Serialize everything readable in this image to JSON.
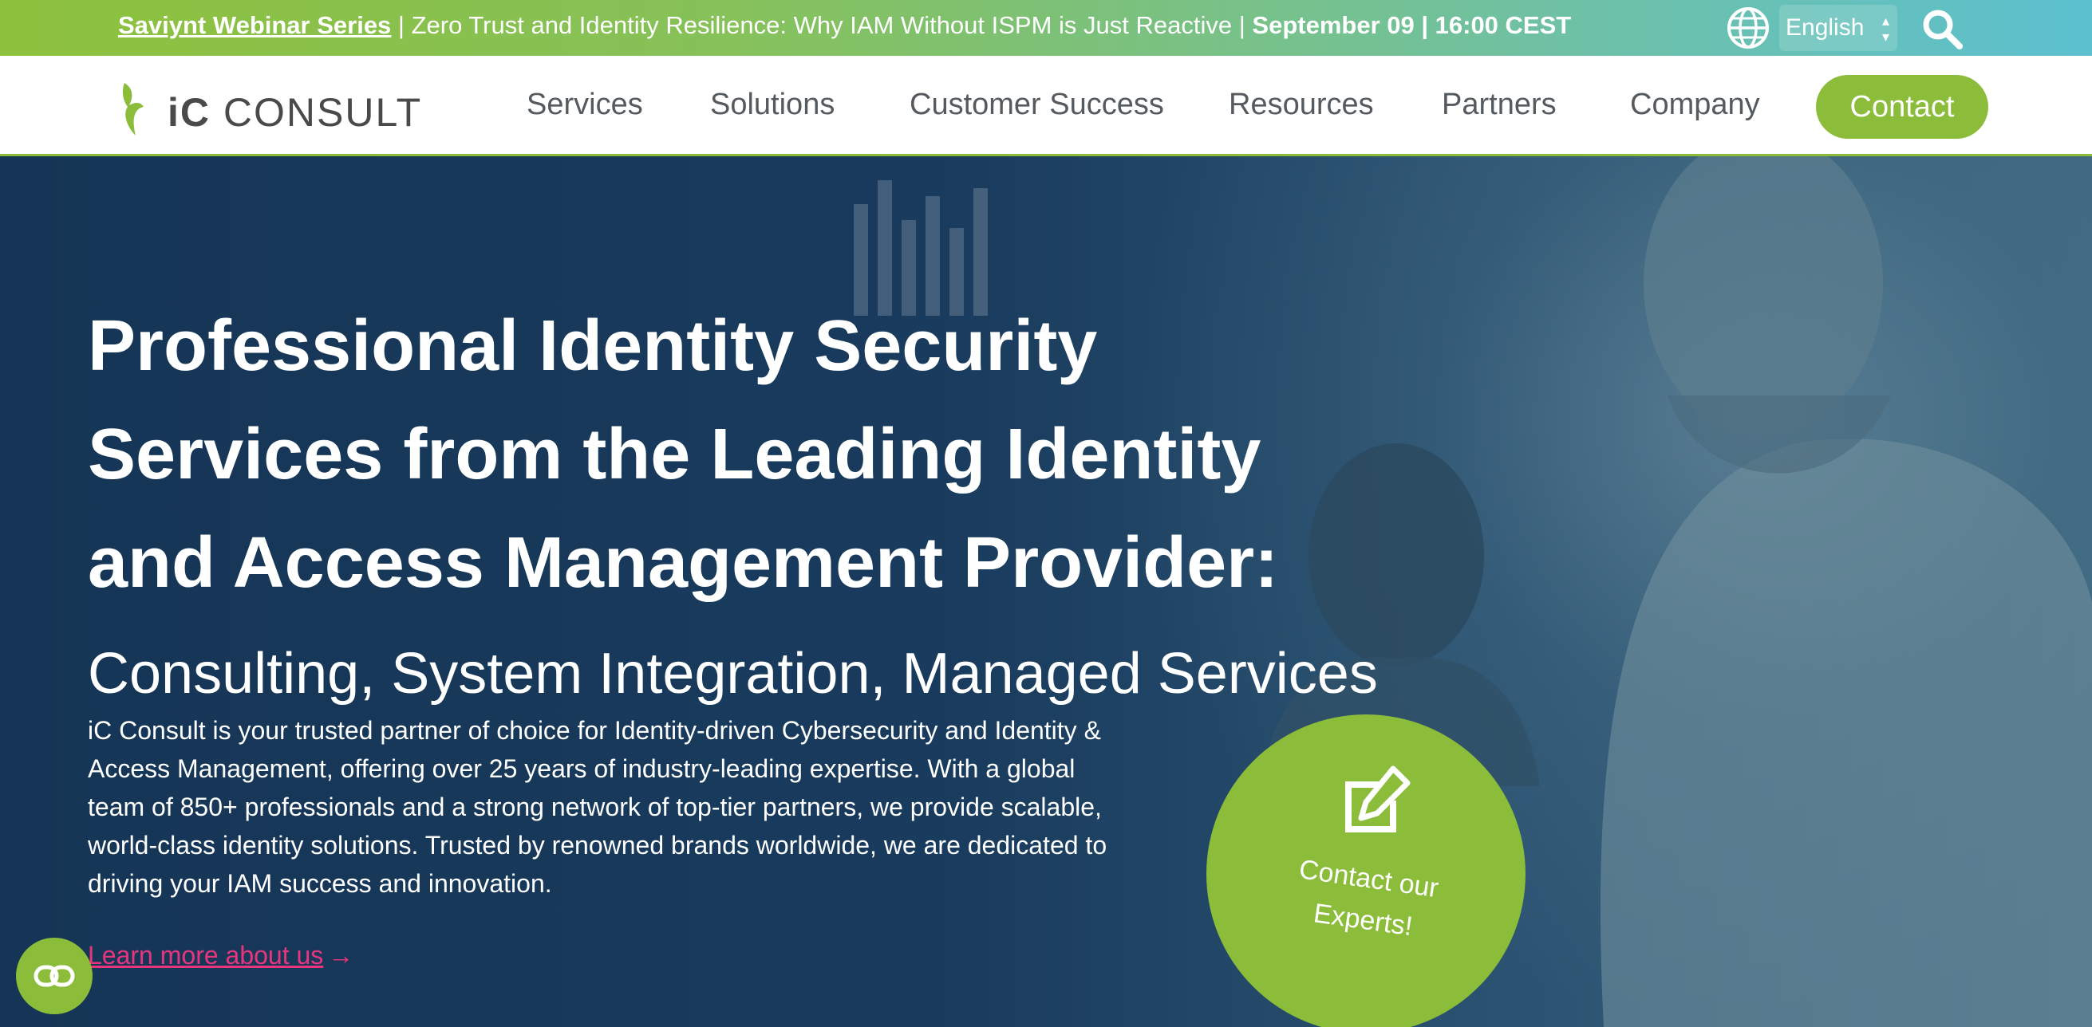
{
  "topbar": {
    "webinar_link": "Saviynt Webinar Series",
    "sep1": " | ",
    "title": "Zero Trust and Identity Resilience: Why IAM Without ISPM is Just Reactive",
    "sep2": " | ",
    "date": "September 09",
    "sep3": " | ",
    "time": "16:00 CEST",
    "language": "English",
    "icons": [
      "globe-icon",
      "search-icon"
    ]
  },
  "nav": {
    "logo_prefix": "iC",
    "logo_name": "CONSULT",
    "items": [
      "Services",
      "Solutions",
      "Customer Success",
      "Resources",
      "Partners",
      "Company"
    ],
    "contact": "Contact"
  },
  "hero": {
    "headline_line1": "Professional Identity Security",
    "headline_line2": "Services from the Leading Identity",
    "headline_line3": "and Access Management Provider:",
    "subheadline": "Consulting, System Integration, Managed Services",
    "description": "iC Consult is your trusted partner of choice for Identity-driven Cybersecurity and Identity & Access Management, offering over 25 years of industry-leading expertise. With a global team of 850+ professionals and a strong network of top-tier partners, we provide scalable, world-class identity solutions. Trusted by renowned brands worldwide, we are dedicated to driving your IAM success and innovation.",
    "learn_more": "Learn more about us",
    "cta_line1": "Contact our",
    "cta_line2": "Experts!"
  },
  "colors": {
    "accent_green": "#8bbd3a",
    "hero_navy": "#193b5d",
    "link_pink": "#e8357e"
  }
}
